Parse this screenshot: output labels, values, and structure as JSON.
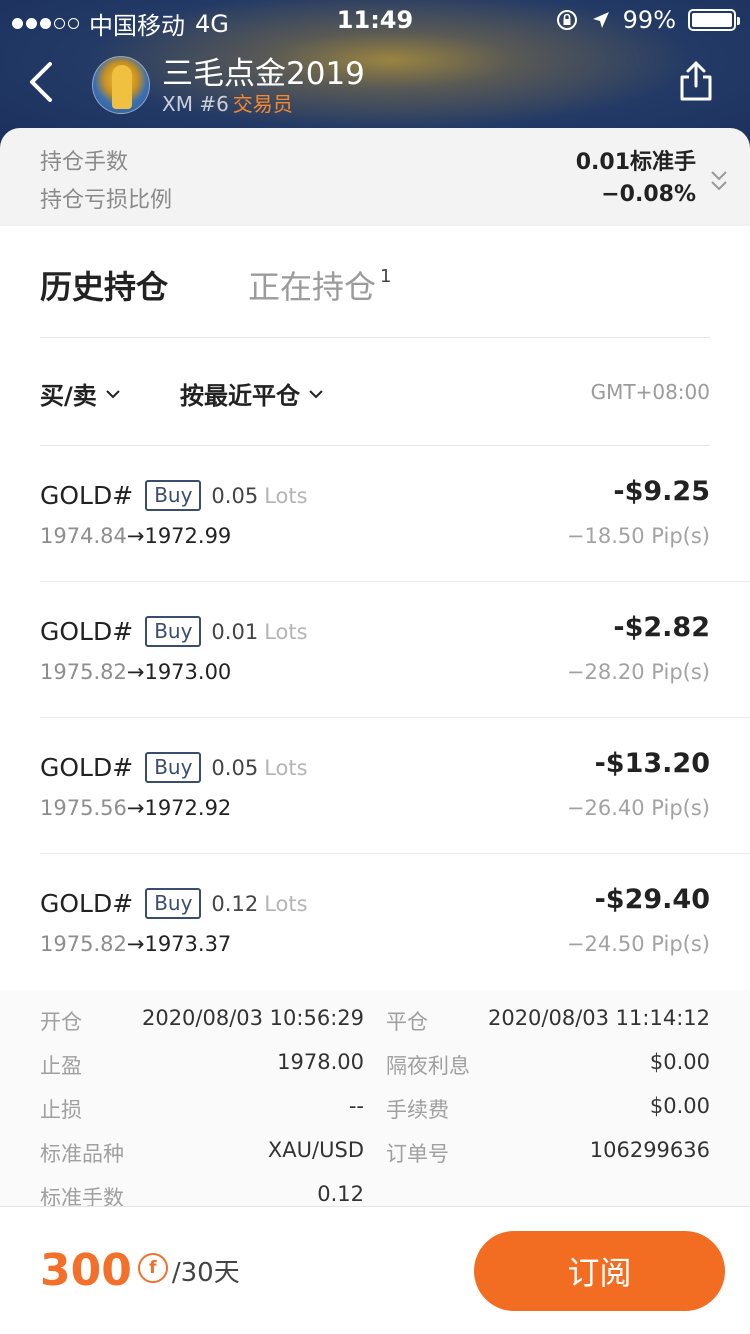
{
  "status_bar": {
    "carrier": "中国移动",
    "network": "4G",
    "time": "11:49",
    "battery": "99%",
    "battery_level": 0.99
  },
  "header": {
    "title": "三毛点金2019",
    "account": "XM #6",
    "role": "交易员"
  },
  "summary": {
    "lots_label": "持仓手数",
    "lots_value": "0.01标准手",
    "pnl_ratio_label": "持仓亏损比例",
    "pnl_ratio_value": "−0.08%"
  },
  "tabs": [
    {
      "label": "历史持仓",
      "active": true
    },
    {
      "label": "正在持仓",
      "count": "1",
      "active": false
    }
  ],
  "filters": {
    "side": "买/卖",
    "sort": "按最近平仓",
    "timezone": "GMT+08:00"
  },
  "trades": [
    {
      "symbol": "GOLD#",
      "side": "Buy",
      "lots": "0.05",
      "lots_unit": "Lots",
      "open": "1974.84",
      "close": "1972.99",
      "pnl": "-$9.25",
      "pips": "−18.50 Pip(s)"
    },
    {
      "symbol": "GOLD#",
      "side": "Buy",
      "lots": "0.01",
      "lots_unit": "Lots",
      "open": "1975.82",
      "close": "1973.00",
      "pnl": "-$2.82",
      "pips": "−28.20 Pip(s)"
    },
    {
      "symbol": "GOLD#",
      "side": "Buy",
      "lots": "0.05",
      "lots_unit": "Lots",
      "open": "1975.56",
      "close": "1972.92",
      "pnl": "-$13.20",
      "pips": "−26.40 Pip(s)"
    },
    {
      "symbol": "GOLD#",
      "side": "Buy",
      "lots": "0.12",
      "lots_unit": "Lots",
      "open": "1975.82",
      "close": "1973.37",
      "pnl": "-$29.40",
      "pips": "−24.50 Pip(s)"
    }
  ],
  "detail": {
    "open_label": "开仓",
    "open_time": "2020/08/03 10:56:29",
    "close_label": "平仓",
    "close_time": "2020/08/03 11:14:12",
    "tp_label": "止盈",
    "tp_value": "1978.00",
    "swap_label": "隔夜利息",
    "swap_value": "$0.00",
    "sl_label": "止损",
    "sl_value": "--",
    "fee_label": "手续费",
    "fee_value": "$0.00",
    "instrument_label": "标准品种",
    "instrument_value": "XAU/USD",
    "order_label": "订单号",
    "order_value": "106299636",
    "std_lots_label": "标准手数",
    "std_lots_value": "0.12"
  },
  "subscription": {
    "price": "300",
    "coin_symbol": "f",
    "period": "/30天",
    "button_label": "订阅"
  }
}
